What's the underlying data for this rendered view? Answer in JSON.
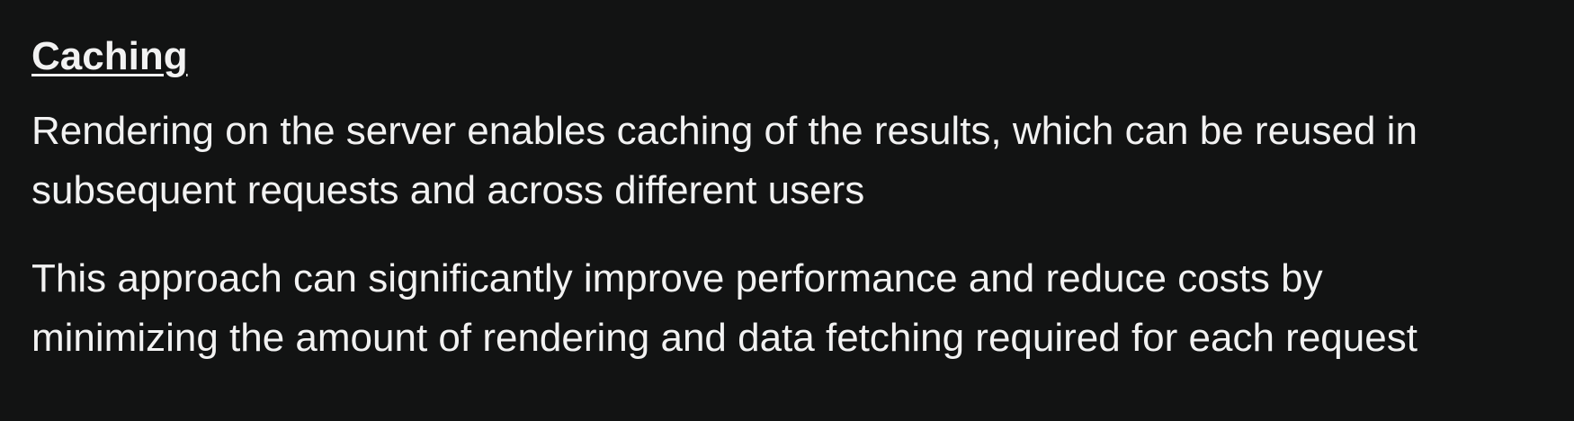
{
  "section": {
    "heading": "Caching",
    "paragraphs": [
      {
        "lines": [
          "Rendering on the server enables caching of the results, which can be reused in",
          "subsequent requests and across different users"
        ]
      },
      {
        "lines": [
          "This approach can significantly improve performance and reduce costs by",
          "minimizing the amount of rendering and data fetching required for each request"
        ]
      }
    ]
  },
  "colors": {
    "background": "#121313",
    "text": "#f2f2f2"
  }
}
